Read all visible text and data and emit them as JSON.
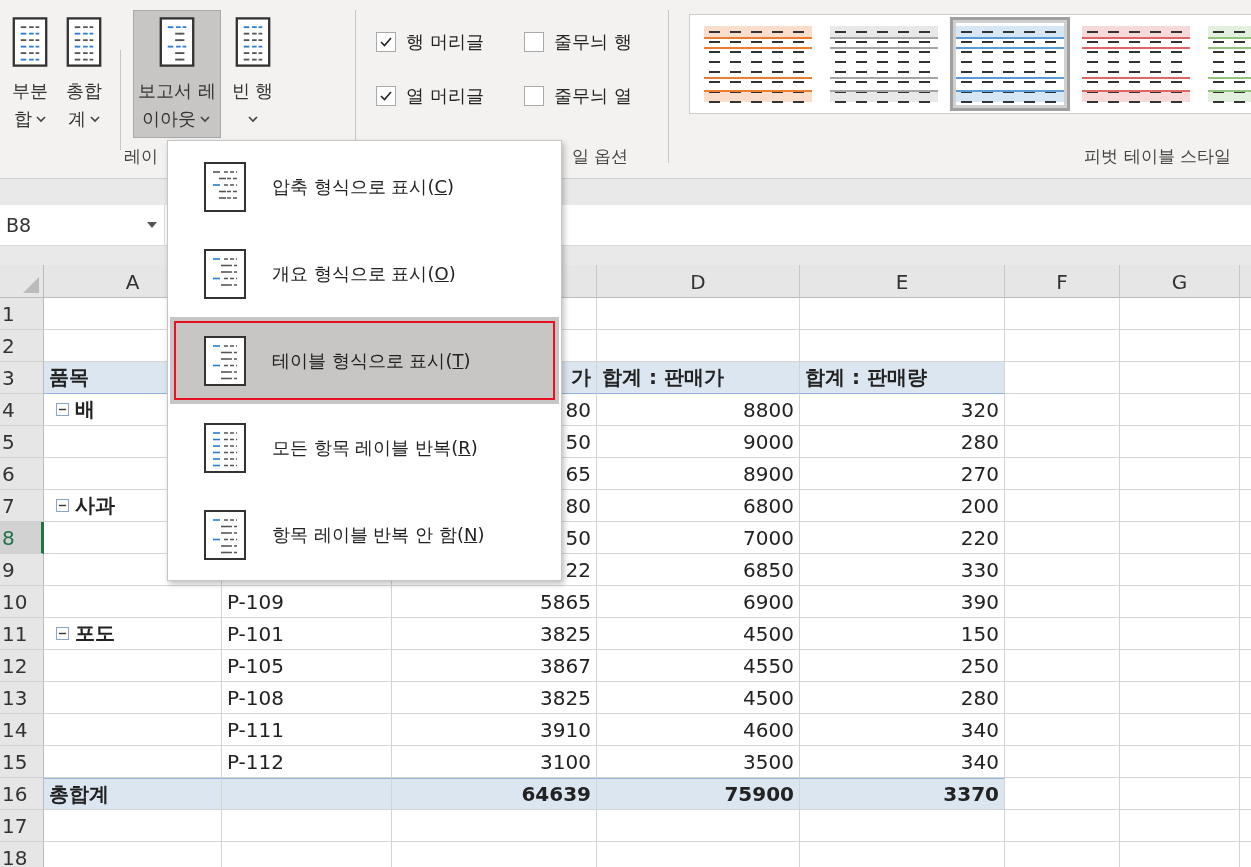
{
  "ribbon": {
    "layout_group": {
      "label": "레이",
      "buttons": [
        {
          "lines": [
            "부분",
            "합"
          ],
          "pressed": false,
          "kind": "subtotal"
        },
        {
          "lines": [
            "총합",
            "계"
          ],
          "pressed": false,
          "kind": "grandtotal"
        },
        {
          "lines": [
            "보고서 레",
            "이아웃"
          ],
          "pressed": true,
          "kind": "layout"
        },
        {
          "lines": [
            "빈 행"
          ],
          "pressed": false,
          "kind": "blank"
        }
      ]
    },
    "options_group": {
      "label": "일 옵션",
      "options": [
        {
          "label": "행 머리글",
          "checked": true
        },
        {
          "label": "줄무늬 행",
          "checked": false
        },
        {
          "label": "열 머리글",
          "checked": true
        },
        {
          "label": "줄무늬 열",
          "checked": false
        }
      ]
    },
    "styles_group": {
      "label": "피벗 테이블 스타일",
      "styles": [
        {
          "color": "#ed7d31",
          "selected": false
        },
        {
          "color": "#a5a5a5",
          "selected": false
        },
        {
          "color": "#5b9bd5",
          "selected": true
        },
        {
          "color": "#e06666",
          "selected": false
        },
        {
          "color": "#93c47d",
          "selected": false
        }
      ]
    }
  },
  "name_box": {
    "value": "B8"
  },
  "sheet": {
    "columns": [
      "A",
      "",
      "",
      "D",
      "E",
      "F",
      "G",
      ""
    ],
    "rows": [
      {
        "num": "1",
        "kind": "blank",
        "selected": false,
        "cells": [
          "",
          "",
          "",
          "",
          ""
        ]
      },
      {
        "num": "2",
        "kind": "blank",
        "selected": false,
        "cells": [
          "",
          "",
          "",
          "",
          ""
        ]
      },
      {
        "num": "3",
        "kind": "header",
        "selected": false,
        "cells": [
          "품목",
          "",
          "가",
          "합계 : 판매가",
          "합계 : 판매량"
        ]
      },
      {
        "num": "4",
        "kind": "data",
        "selected": false,
        "expanded": true,
        "cells": [
          "배",
          "",
          "80",
          "8800",
          "320"
        ]
      },
      {
        "num": "5",
        "kind": "data",
        "selected": false,
        "cells": [
          "",
          "",
          "50",
          "9000",
          "280"
        ]
      },
      {
        "num": "6",
        "kind": "data",
        "selected": false,
        "cells": [
          "",
          "",
          "65",
          "8900",
          "270"
        ]
      },
      {
        "num": "7",
        "kind": "data",
        "selected": false,
        "expanded": true,
        "cells": [
          "사과",
          "",
          "80",
          "6800",
          "200"
        ]
      },
      {
        "num": "8",
        "kind": "data",
        "selected": true,
        "cells": [
          "",
          "",
          "50",
          "7000",
          "220"
        ]
      },
      {
        "num": "9",
        "kind": "data",
        "selected": false,
        "cells": [
          "",
          "",
          "22",
          "6850",
          "330"
        ]
      },
      {
        "num": "10",
        "kind": "data",
        "selected": false,
        "cells": [
          "",
          "P-109",
          "5865",
          "6900",
          "390"
        ]
      },
      {
        "num": "11",
        "kind": "data",
        "selected": false,
        "expanded": true,
        "cells": [
          "포도",
          "P-101",
          "3825",
          "4500",
          "150"
        ]
      },
      {
        "num": "12",
        "kind": "data",
        "selected": false,
        "cells": [
          "",
          "P-105",
          "3867",
          "4550",
          "250"
        ]
      },
      {
        "num": "13",
        "kind": "data",
        "selected": false,
        "cells": [
          "",
          "P-108",
          "3825",
          "4500",
          "280"
        ]
      },
      {
        "num": "14",
        "kind": "data",
        "selected": false,
        "cells": [
          "",
          "P-111",
          "3910",
          "4600",
          "340"
        ]
      },
      {
        "num": "15",
        "kind": "data",
        "selected": false,
        "cells": [
          "",
          "P-112",
          "3100",
          "3500",
          "340"
        ]
      },
      {
        "num": "16",
        "kind": "total",
        "selected": false,
        "cells": [
          "총합계",
          "",
          "64639",
          "75900",
          "3370"
        ]
      },
      {
        "num": "17",
        "kind": "blank",
        "selected": false,
        "cells": [
          "",
          "",
          "",
          "",
          ""
        ]
      },
      {
        "num": "18",
        "kind": "blank",
        "selected": false,
        "cells": [
          "",
          "",
          "",
          "",
          ""
        ]
      }
    ]
  },
  "layout_menu": {
    "items": [
      {
        "label": "압축 형식으로 표시(C)",
        "kind": "compact",
        "selected": false,
        "outlined": false
      },
      {
        "label": "개요 형식으로 표시(O)",
        "kind": "outline",
        "selected": false,
        "outlined": false
      },
      {
        "label": "테이블 형식으로 표시(T)",
        "kind": "tabular",
        "selected": true,
        "outlined": true
      },
      {
        "label": "모든 항목 레이블 반복(R)",
        "kind": "repeat",
        "selected": false,
        "outlined": false
      },
      {
        "label": "항목 레이블 반복 안 함(N)",
        "kind": "norepeat",
        "selected": false,
        "outlined": false
      }
    ]
  }
}
